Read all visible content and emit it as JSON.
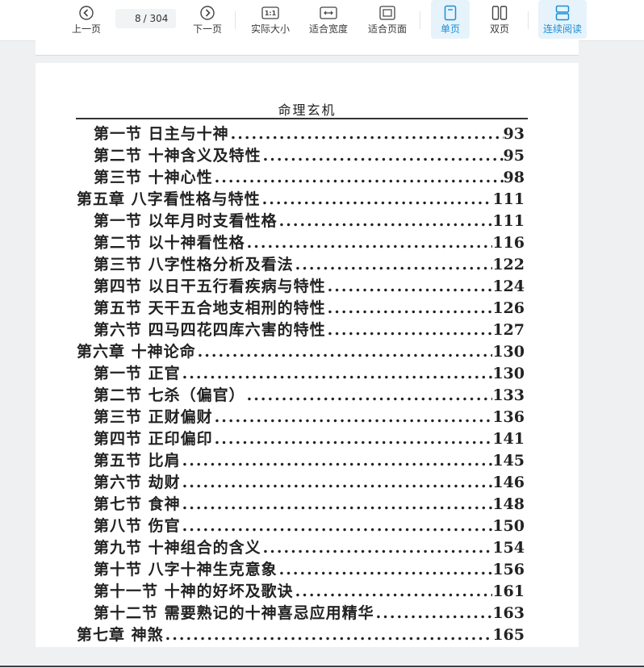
{
  "toolbar": {
    "prev_label": "上一页",
    "next_label": "下一页",
    "page_current": "8",
    "page_total": "/ 304",
    "actual_size_label": "实际大小",
    "fit_width_label": "适合宽度",
    "fit_page_label": "适合页面",
    "single_label": "单页",
    "double_label": "双页",
    "continuous_label": "连续阅读",
    "actual_size_glyph": "1:1",
    "accent": "#1a8fd6"
  },
  "page": {
    "running_head": "命理玄机",
    "toc": [
      {
        "text": "第一节  日主与十神",
        "page": "93",
        "level": 2
      },
      {
        "text": "第二节  十神含义及特性",
        "page": "95",
        "level": 2
      },
      {
        "text": "第三节  十神心性",
        "page": "98",
        "level": 2
      },
      {
        "text": "第五章  八字看性格与特性",
        "page": "111",
        "level": 1
      },
      {
        "text": "第一节  以年月时支看性格",
        "page": "111",
        "level": 2
      },
      {
        "text": "第二节  以十神看性格",
        "page": "116",
        "level": 2
      },
      {
        "text": "第三节  八字性格分析及看法",
        "page": "122",
        "level": 2
      },
      {
        "text": "第四节  以日干五行看疾病与特性",
        "page": "124",
        "level": 2
      },
      {
        "text": "第五节  天干五合地支相刑的特性",
        "page": "126",
        "level": 2
      },
      {
        "text": "第六节  四马四花四库六害的特性",
        "page": "127",
        "level": 2
      },
      {
        "text": "第六章  十神论命",
        "page": "130",
        "level": 1
      },
      {
        "text": "第一节  正官",
        "page": "130",
        "level": 2
      },
      {
        "text": "第二节  七杀（偏官）",
        "page": "133",
        "level": 2
      },
      {
        "text": "第三节  正财偏财",
        "page": "136",
        "level": 2
      },
      {
        "text": "第四节  正印偏印",
        "page": "141",
        "level": 2
      },
      {
        "text": "第五节  比肩",
        "page": "145",
        "level": 2
      },
      {
        "text": "第六节  劫财",
        "page": "146",
        "level": 2
      },
      {
        "text": "第七节  食神",
        "page": "148",
        "level": 2
      },
      {
        "text": "第八节  伤官",
        "page": "150",
        "level": 2
      },
      {
        "text": "第九节  十神组合的含义",
        "page": "154",
        "level": 2
      },
      {
        "text": "第十节  八字十神生克意象",
        "page": "156",
        "level": 2
      },
      {
        "text": "第十一节  十神的好坏及歌诀",
        "page": "161",
        "level": 2
      },
      {
        "text": "第十二节  需要熟记的十神喜忌应用精华",
        "page": "163",
        "level": 2
      },
      {
        "text": "第七章  神煞",
        "page": "165",
        "level": 1
      }
    ]
  }
}
